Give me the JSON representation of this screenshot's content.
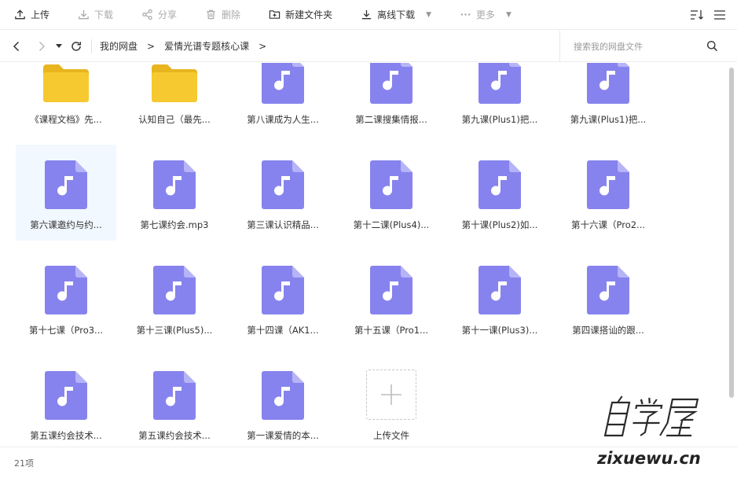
{
  "toolbar": {
    "upload": "上传",
    "download": "下载",
    "share": "分享",
    "delete": "删除",
    "new_folder": "新建文件夹",
    "offline_download": "离线下载",
    "more": "更多"
  },
  "nav": {
    "breadcrumbs": [
      "我的网盘",
      "爱情光谱专题核心课"
    ],
    "search_placeholder": "搜索我的网盘文件"
  },
  "files": [
    {
      "name": "《课程文档》先...",
      "type": "folder"
    },
    {
      "name": "认知自己（最先...",
      "type": "folder"
    },
    {
      "name": "第八课成为人生...",
      "type": "audio"
    },
    {
      "name": "第二课搜集情报...",
      "type": "audio"
    },
    {
      "name": "第九课(Plus1)把...",
      "type": "audio"
    },
    {
      "name": "第九课(Plus1)把...",
      "type": "audio"
    },
    {
      "name": "第六课邀约与约...",
      "type": "audio",
      "selected": true
    },
    {
      "name": "第七课约会.mp3",
      "type": "audio"
    },
    {
      "name": "第三课认识精品...",
      "type": "audio"
    },
    {
      "name": "第十二课(Plus4)...",
      "type": "audio"
    },
    {
      "name": "第十课(Plus2)如...",
      "type": "audio"
    },
    {
      "name": "第十六课（Pro2...",
      "type": "audio"
    },
    {
      "name": "第十七课（Pro3...",
      "type": "audio"
    },
    {
      "name": "第十三课(Plus5)...",
      "type": "audio"
    },
    {
      "name": "第十四课（AK1...",
      "type": "audio"
    },
    {
      "name": "第十五课（Pro1...",
      "type": "audio"
    },
    {
      "name": "第十一课(Plus3)...",
      "type": "audio"
    },
    {
      "name": "第四课搭讪的跟...",
      "type": "audio"
    },
    {
      "name": "第五课约会技术...",
      "type": "audio"
    },
    {
      "name": "第五课约会技术...",
      "type": "audio"
    },
    {
      "name": "第一课爱情的本...",
      "type": "audio"
    }
  ],
  "upload_tile": {
    "label": "上传文件"
  },
  "status": {
    "item_count": "21项"
  },
  "watermark": {
    "line1": "自学屋",
    "line2": "zixuewu.cn"
  },
  "colors": {
    "folder": "#f7c930",
    "audio": "#8683ee",
    "selected_bg": "#f1f8ff"
  },
  "icons": {
    "folder": "folder-icon",
    "audio": "music-note-icon",
    "upload": "upload-icon",
    "download": "download-icon",
    "share": "share-icon",
    "delete": "trash-icon",
    "new_folder": "new-folder-icon",
    "offline_download": "offline-download-icon",
    "more": "more-dots-icon",
    "sort": "sort-icon",
    "menu": "menu-icon",
    "back": "back-arrow-icon",
    "forward": "forward-arrow-icon",
    "refresh": "refresh-icon",
    "search": "search-icon",
    "add": "plus-icon"
  }
}
